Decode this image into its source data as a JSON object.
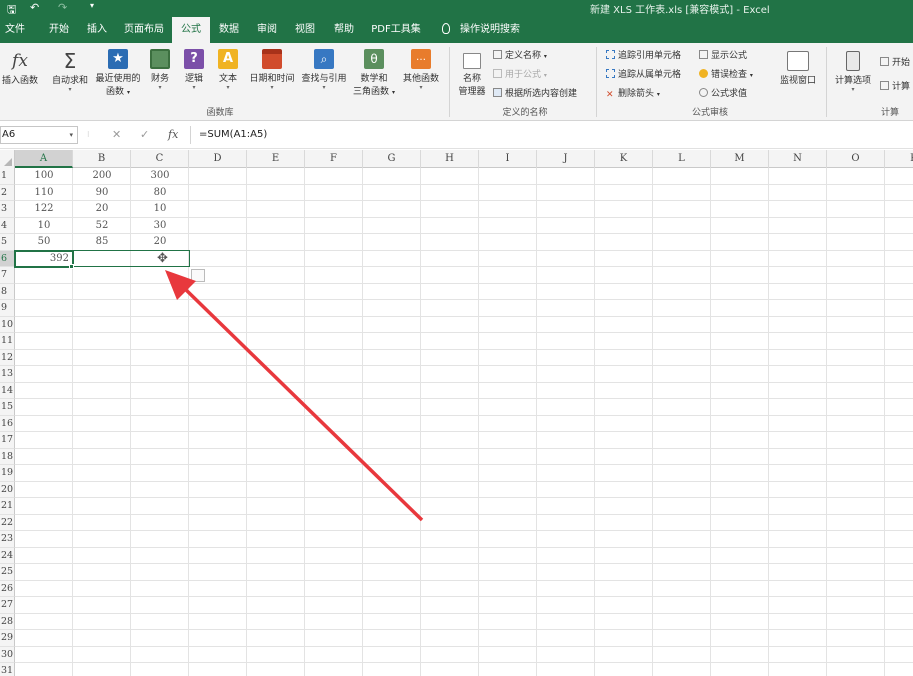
{
  "title_bar": {
    "doc_title": "新建 XLS 工作表.xls  [兼容模式]  -  Excel",
    "qa_save": "🖫",
    "qa_undo": "↶",
    "qa_redo": "↷",
    "qa_more": "▾"
  },
  "tabs": [
    "文件",
    "开始",
    "插入",
    "页面布局",
    "公式",
    "数据",
    "审阅",
    "视图",
    "帮助",
    "PDF工具集",
    "操作说明搜索"
  ],
  "ribbon": {
    "function_library": {
      "buttons": [
        {
          "label": "插入函数",
          "label2": "",
          "icon": "fx-icon"
        },
        {
          "label": "自动求和",
          "label2": "",
          "icon": "sigma-icon"
        },
        {
          "label": "最近使用的",
          "label2": "函数",
          "icon": "star-icon"
        },
        {
          "label": "财务",
          "label2": "",
          "icon": "finance-book-icon"
        },
        {
          "label": "逻辑",
          "label2": "",
          "icon": "logic-book-icon"
        },
        {
          "label": "文本",
          "label2": "",
          "icon": "text-book-icon"
        },
        {
          "label": "日期和时间",
          "label2": "",
          "icon": "calendar-icon"
        },
        {
          "label": "查找与引用",
          "label2": "",
          "icon": "lookup-icon"
        },
        {
          "label": "数学和",
          "label2": "三角函数",
          "icon": "math-icon"
        },
        {
          "label": "其他函数",
          "label2": "",
          "icon": "more-functions-icon"
        }
      ],
      "group_label": "函数库"
    },
    "defined_names": {
      "name_manager": "名称",
      "name_manager2": "管理器",
      "define_name": "定义名称",
      "use_in_formula": "用于公式",
      "create_from_selection": "根据所选内容创建",
      "group_label": "定义的名称"
    },
    "formula_auditing": {
      "trace_precedents": "追踪引用单元格",
      "trace_dependents": "追踪从属单元格",
      "remove_arrows": "删除箭头",
      "show_formulas": "显示公式",
      "error_checking": "错误检查",
      "evaluate_formula": "公式求值",
      "watch_window": "监视窗口",
      "group_label": "公式审核"
    },
    "calculation": {
      "calc_options": "计算选项",
      "calc_now": "开始",
      "calc_sheet": "计算",
      "group_label": "计算"
    }
  },
  "formula_bar": {
    "name_box": "A6",
    "cancel": "✕",
    "enter": "✓",
    "fx": "fx",
    "formula": "=SUM(A1:A5)"
  },
  "columns": [
    "A",
    "B",
    "C",
    "D",
    "E",
    "F",
    "G",
    "H",
    "I",
    "J",
    "K",
    "L",
    "M",
    "N",
    "O",
    "P"
  ],
  "rows": [
    "1",
    "2",
    "3",
    "4",
    "5",
    "6",
    "7",
    "8",
    "9",
    "10",
    "11",
    "12",
    "13",
    "14",
    "15",
    "16",
    "17",
    "18",
    "19",
    "20",
    "21",
    "22",
    "23",
    "24",
    "25",
    "26",
    "27",
    "28",
    "29",
    "30",
    "31"
  ],
  "cells": [
    [
      "100",
      "200",
      "300"
    ],
    [
      "110",
      "90",
      "80"
    ],
    [
      "122",
      "20",
      "10"
    ],
    [
      "10",
      "52",
      "30"
    ],
    [
      "50",
      "85",
      "20"
    ],
    [
      "392",
      "",
      ""
    ]
  ],
  "colors": {
    "accent": "#217346",
    "arrow": "#e8383d"
  }
}
